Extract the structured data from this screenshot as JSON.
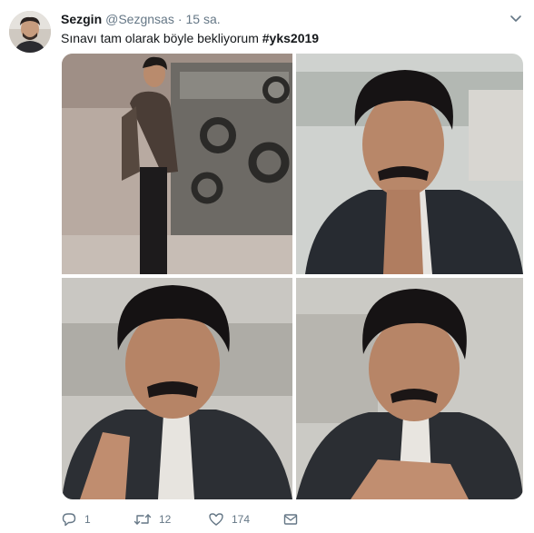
{
  "user": {
    "name": "Sezgin",
    "handle": "@Sezgnsas",
    "separator": "·",
    "time": "15 sa."
  },
  "tweet": {
    "text": "Sınavı tam olarak böyle bekliyorum",
    "hashtag": "#yks2019"
  },
  "actions": {
    "reply_count": "1",
    "retweet_count": "12",
    "like_count": "174"
  },
  "icons": {
    "more": "chevron-down-icon",
    "reply": "reply-icon",
    "retweet": "retweet-icon",
    "like": "heart-icon",
    "dm": "envelope-icon"
  },
  "colors": {
    "text": "#14171a",
    "secondary": "#657786"
  }
}
